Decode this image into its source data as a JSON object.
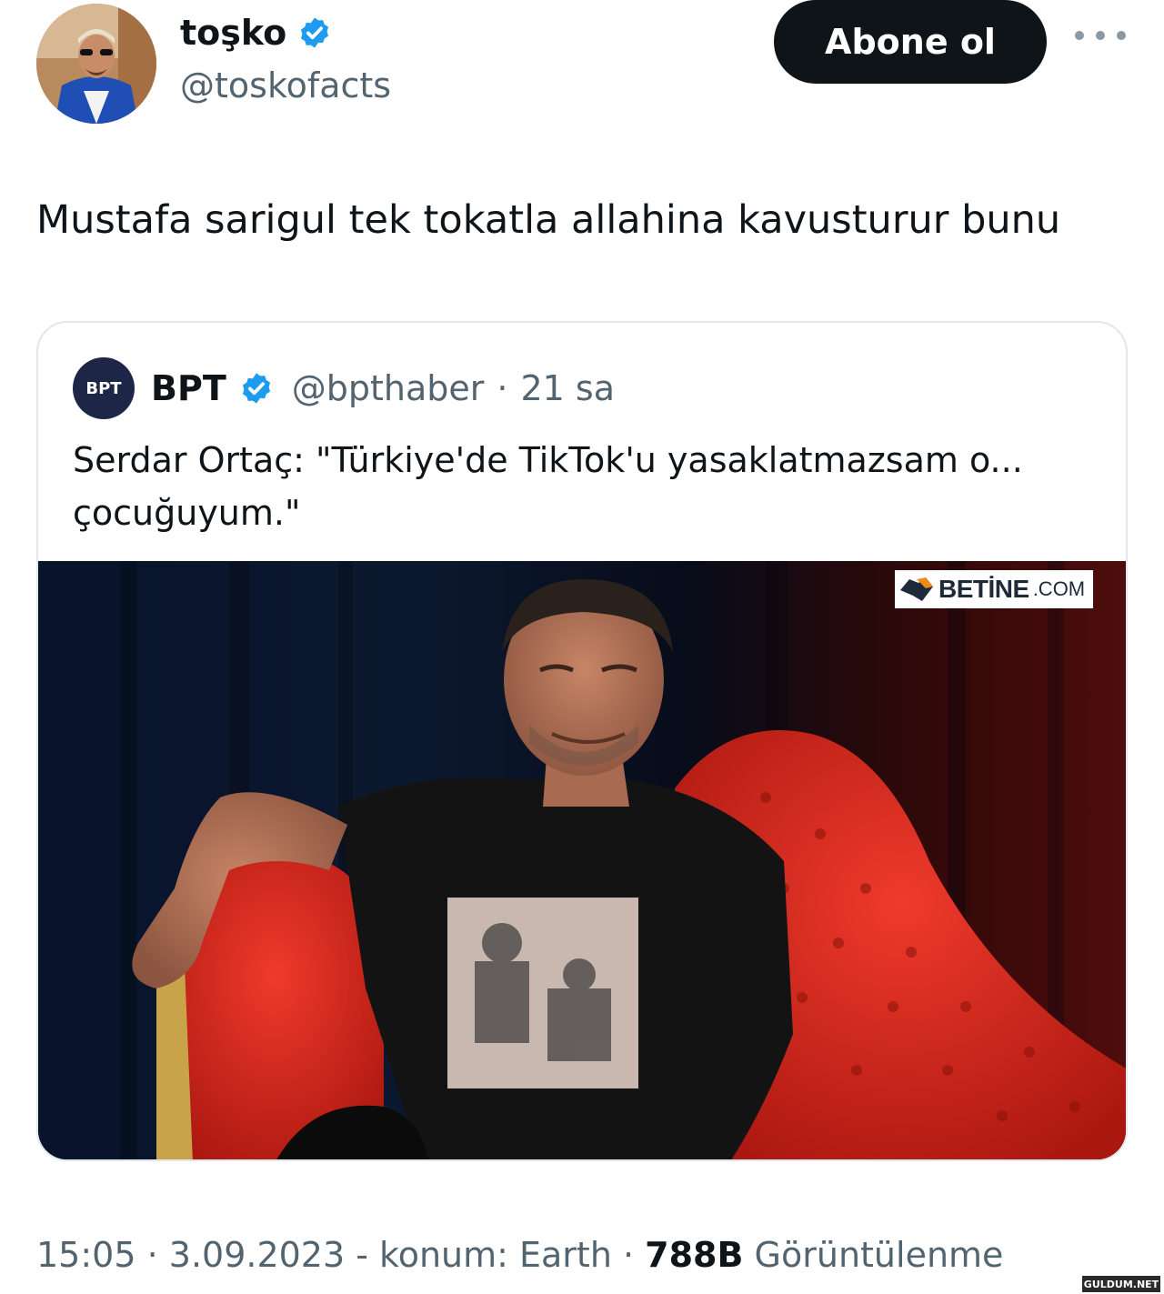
{
  "author": {
    "display_name": "toşko",
    "handle": "@toskofacts",
    "avatar_icon": "profile-photo",
    "verified_icon": "verified-badge-icon"
  },
  "actions": {
    "follow_label": "Abone ol",
    "more_icon": "more-options-icon"
  },
  "tweet": {
    "text": "Mustafa sarigul tek tokatla allahina kavusturur bunu"
  },
  "quoted_tweet": {
    "avatar_label": "BPT",
    "display_name": "BPT",
    "handle": "@bpthaber",
    "separator": "·",
    "time": "21 sa",
    "text": "Serdar Ortaç: \"Türkiye'de TikTok'u yasaklatmazsam o... çocuğuyum.\"",
    "image": {
      "description_icon": "photo-man-on-red-sofa",
      "watermark_text": "BETİNE",
      "watermark_suffix": ".COM"
    }
  },
  "meta": {
    "time": "15:05",
    "sep1": " · ",
    "date": "3.09.2023",
    "location": " - konum: Earth",
    "sep2": " · ",
    "views_count": "788B",
    "views_label": " Görüntülenme"
  },
  "site_watermark": "GULDUM.NET",
  "colors": {
    "text": "#0f1419",
    "secondary": "#536471",
    "verified": "#1d9bf0",
    "button_bg": "#0f1419",
    "border": "#e1e8ed",
    "sofa_red": "#d4281f"
  }
}
